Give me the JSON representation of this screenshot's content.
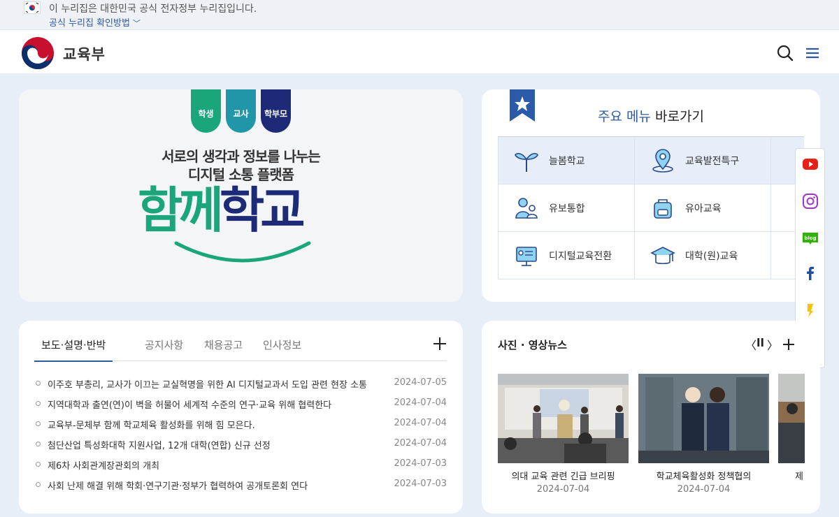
{
  "gov_banner": {
    "text": "이 누리집은 대한민국 공식 전자정부 누리집입니다.",
    "link": "공식 누리집 확인방법"
  },
  "header": {
    "logo_text": "교육부"
  },
  "hero": {
    "tags": [
      "학생",
      "교사",
      "학부모"
    ],
    "subtitle_line1": "서로의 생각과 정보를 나누는",
    "subtitle_line2": "디지털 소통 플랫폼",
    "title_part1": "함께",
    "title_part2": "학교"
  },
  "quick_menu": {
    "title_highlight": "주요 메뉴",
    "title_rest": " 바로가기",
    "items": [
      {
        "label": "늘봄학교"
      },
      {
        "label": "교육발전특구"
      },
      {
        "label": "유보통합"
      },
      {
        "label": "유아교육"
      },
      {
        "label": "디지털교육전환"
      },
      {
        "label": "대학(원)교육"
      }
    ]
  },
  "news": {
    "tabs": [
      "보도·설명·반박",
      "공지사항",
      "채용공고",
      "인사정보"
    ],
    "items": [
      {
        "title": "이주호 부총리, 교사가 이끄는 교실혁명을 위한 AI 디지털교과서 도입 관련 현장 소통",
        "date": "2024-07-05"
      },
      {
        "title": "지역대학과 출연(연)이 벽을 허물어 세계적 수준의 연구·교육 위해 협력한다",
        "date": "2024-07-04"
      },
      {
        "title": "교육부-문체부 함께 학교체육 활성화를 위해 힘 모은다.",
        "date": "2024-07-04"
      },
      {
        "title": "첨단산업 특성화대학 지원사업, 12개 대학(연합) 신규 선정",
        "date": "2024-07-04"
      },
      {
        "title": "제6차 사회관계장관회의 개최",
        "date": "2024-07-03"
      },
      {
        "title": "사회 난제 해결 위해 학회·연구기관·정부가 협력하여 공개토론회 연다",
        "date": "2024-07-03"
      }
    ]
  },
  "photo_news": {
    "title": "사진 · 영상뉴스",
    "items": [
      {
        "caption": "의대 교육 관련 긴급 브리핑",
        "date": "2024-07-04"
      },
      {
        "caption": "학교체육활성화 정책협의",
        "date": "2024-07-04"
      },
      {
        "caption": "제",
        "date": ""
      }
    ]
  },
  "colors": {
    "brand_blue": "#2a5aa8",
    "green": "#1aa67a",
    "teal": "#2196a8",
    "navy": "#1c2a78"
  }
}
